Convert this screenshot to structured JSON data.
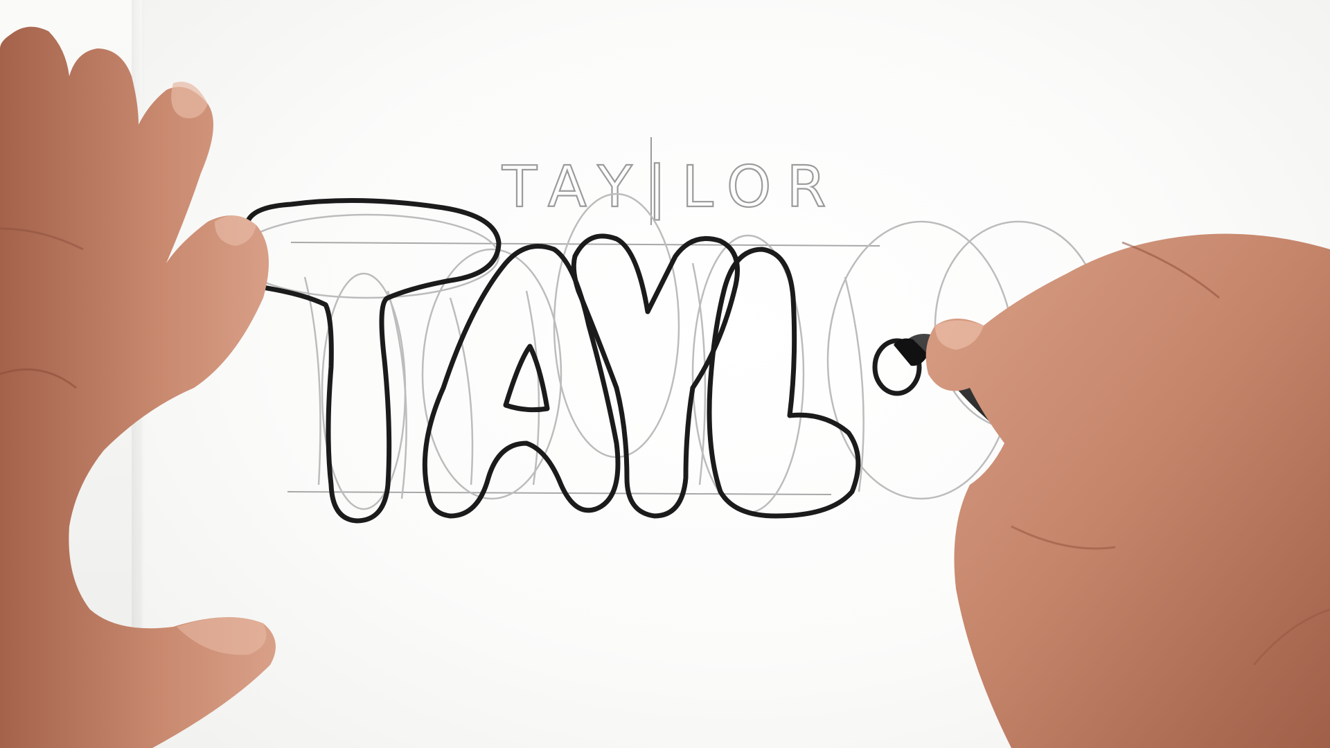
{
  "scene": {
    "description_label": "",
    "pencil_sketch_text": "TAY|LOR",
    "inked_letters": [
      "T",
      "A",
      "Y",
      "L",
      "O"
    ],
    "colors": {
      "paper": "#fbfbfa",
      "pencil": "#9b9b9b",
      "ink": "#1b1b1b",
      "skin": "#c8876e",
      "marker_body": "#2a2a2a",
      "marker_label": "#dcdcdc"
    }
  }
}
